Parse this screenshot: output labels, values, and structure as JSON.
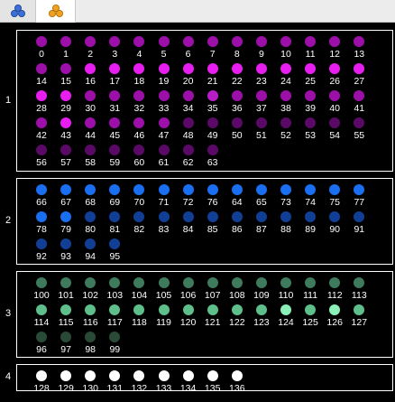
{
  "tabs": [
    {
      "icon": "three-circles-blue-icon",
      "color": "#3a6fd8",
      "selected": false
    },
    {
      "icon": "three-circles-orange-icon",
      "color": "#f0a020",
      "selected": true
    }
  ],
  "groups": [
    {
      "label": "1",
      "rows": [
        {
          "labels": [
            "0",
            "1",
            "2",
            "3",
            "4",
            "5",
            "6",
            "7",
            "8",
            "9",
            "10",
            "11",
            "12",
            "13"
          ],
          "colors": [
            "#9c0fa8",
            "#9c0fa8",
            "#9c0fa8",
            "#9c0fa8",
            "#9c0fa8",
            "#9c0fa8",
            "#9c0fa8",
            "#9c0fa8",
            "#9c0fa8",
            "#9c0fa8",
            "#9c0fa8",
            "#9c0fa8",
            "#9c0fa8",
            "#9c0fa8"
          ]
        },
        {
          "labels": [
            "14",
            "15",
            "16",
            "17",
            "18",
            "19",
            "20",
            "21",
            "22",
            "23",
            "24",
            "25",
            "26",
            "27"
          ],
          "colors": [
            "#9c0fa8",
            "#9c0fa8",
            "#e81ef0",
            "#e81ef0",
            "#e81ef0",
            "#e81ef0",
            "#e81ef0",
            "#e81ef0",
            "#e81ef0",
            "#e81ef0",
            "#e81ef0",
            "#e81ef0",
            "#e81ef0",
            "#e81ef0"
          ]
        },
        {
          "labels": [
            "28",
            "29",
            "30",
            "31",
            "32",
            "33",
            "34",
            "35",
            "36",
            "37",
            "38",
            "39",
            "40",
            "41"
          ],
          "colors": [
            "#e81ef0",
            "#e81ef0",
            "#9c0fa8",
            "#9c0fa8",
            "#9c0fa8",
            "#9c0fa8",
            "#9c0fa8",
            "#b81ec8",
            "#9c0fa8",
            "#9c0fa8",
            "#9c0fa8",
            "#9c0fa8",
            "#9c0fa8",
            "#9c0fa8"
          ]
        },
        {
          "labels": [
            "42",
            "43",
            "44",
            "45",
            "46",
            "47",
            "48",
            "49",
            "50",
            "51",
            "52",
            "53",
            "54",
            "55"
          ],
          "colors": [
            "#9c0fa8",
            "#e81ef0",
            "#9c0fa8",
            "#9c0fa8",
            "#9c0fa8",
            "#9c0fa8",
            "#5a0a66",
            "#5a0a66",
            "#5a0a66",
            "#5a0a66",
            "#5a0a66",
            "#5a0a66",
            "#5a0a66",
            "#5a0a66"
          ]
        },
        {
          "labels": [
            "56",
            "57",
            "58",
            "59",
            "60",
            "61",
            "62",
            "63"
          ],
          "colors": [
            "#5a0a66",
            "#5a0a66",
            "#5a0a66",
            "#5a0a66",
            "#5a0a66",
            "#5a0a66",
            "#5a0a66",
            "#5a0a66"
          ]
        }
      ]
    },
    {
      "label": "2",
      "rows": [
        {
          "labels": [
            "66",
            "67",
            "68",
            "69",
            "70",
            "71",
            "72",
            "76",
            "64",
            "65",
            "73",
            "74",
            "75",
            "77"
          ],
          "colors": [
            "#1a6ef0",
            "#1a6ef0",
            "#1a6ef0",
            "#1a6ef0",
            "#1a6ef0",
            "#1a6ef0",
            "#1a6ef0",
            "#1a6ef0",
            "#1a6ef0",
            "#1a6ef0",
            "#1a6ef0",
            "#1a6ef0",
            "#1a6ef0",
            "#1a6ef0"
          ]
        },
        {
          "labels": [
            "78",
            "79",
            "80",
            "81",
            "82",
            "83",
            "84",
            "85",
            "86",
            "87",
            "88",
            "89",
            "90",
            "91"
          ],
          "colors": [
            "#1a6ef0",
            "#1a6ef0",
            "#123f96",
            "#123f96",
            "#123f96",
            "#123f96",
            "#123f96",
            "#123f96",
            "#123f96",
            "#123f96",
            "#123f96",
            "#123f96",
            "#123f96",
            "#123f96"
          ]
        },
        {
          "labels": [
            "92",
            "93",
            "94",
            "95"
          ],
          "colors": [
            "#123f96",
            "#123f96",
            "#123f96",
            "#123f96"
          ]
        }
      ]
    },
    {
      "label": "3",
      "rows": [
        {
          "labels": [
            "100",
            "101",
            "102",
            "103",
            "104",
            "105",
            "106",
            "107",
            "108",
            "109",
            "110",
            "111",
            "112",
            "113"
          ],
          "colors": [
            "#3e7a5c",
            "#3e7a5c",
            "#3e7a5c",
            "#3e7a5c",
            "#3e7a5c",
            "#3e7a5c",
            "#3e7a5c",
            "#3e7a5c",
            "#3e7a5c",
            "#3e7a5c",
            "#3e7a5c",
            "#3e7a5c",
            "#3e7a5c",
            "#3e7a5c"
          ]
        },
        {
          "labels": [
            "114",
            "115",
            "116",
            "117",
            "118",
            "119",
            "120",
            "121",
            "122",
            "123",
            "124",
            "125",
            "126",
            "127"
          ],
          "colors": [
            "#5fbf8a",
            "#5fbf8a",
            "#5fbf8a",
            "#5fbf8a",
            "#5fbf8a",
            "#5fbf8a",
            "#5fbf8a",
            "#5fbf8a",
            "#5fbf8a",
            "#5fbf8a",
            "#8af0b8",
            "#5fbf8a",
            "#8af0b8",
            "#5fbf8a"
          ]
        },
        {
          "labels": [
            "96",
            "97",
            "98",
            "99"
          ],
          "colors": [
            "#2a4a38",
            "#2a4a38",
            "#2a4a38",
            "#2a4a38"
          ]
        }
      ]
    },
    {
      "label": "4",
      "rows": [
        {
          "labels": [
            "128",
            "129",
            "130",
            "131",
            "132",
            "133",
            "134",
            "135",
            "136"
          ],
          "colors": [
            "#ffffff",
            "#ffffff",
            "#ffffff",
            "#ffffff",
            "#ffffff",
            "#ffffff",
            "#ffffff",
            "#ffffff",
            "#ffffff"
          ]
        }
      ]
    }
  ]
}
